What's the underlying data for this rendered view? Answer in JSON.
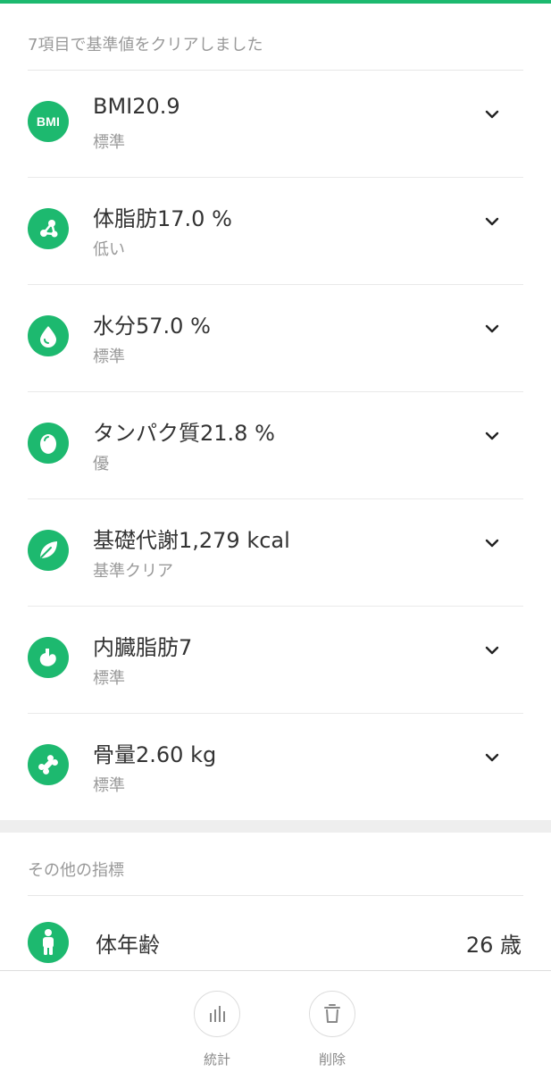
{
  "main": {
    "summary": "7項目で基準値をクリアしました",
    "metrics": [
      {
        "icon": "bmi-icon",
        "icon_text": "BMI",
        "title": "BMI20.9",
        "status": "標準"
      },
      {
        "icon": "molecule-icon",
        "title": "体脂肪17.0 %",
        "status": "低い"
      },
      {
        "icon": "water-drop-icon",
        "title": "水分57.0 %",
        "status": "標準"
      },
      {
        "icon": "egg-icon",
        "title": "タンパク質21.8 %",
        "status": "優"
      },
      {
        "icon": "leaf-icon",
        "title": "基礎代謝1,279  kcal",
        "status": "基準クリア"
      },
      {
        "icon": "stomach-icon",
        "title": "内臓脂肪7",
        "status": "標準"
      },
      {
        "icon": "bone-icon",
        "title": "骨量2.60 kg",
        "status": "標準"
      }
    ]
  },
  "other": {
    "header": "その他の指標",
    "items": [
      {
        "icon": "person-icon",
        "label": "体年齢",
        "value": "26 歳"
      }
    ]
  },
  "bottom_bar": {
    "stats_label": "統計",
    "delete_label": "削除"
  },
  "colors": {
    "accent": "#1db96f",
    "text_primary": "#333333",
    "text_secondary": "#999999"
  }
}
